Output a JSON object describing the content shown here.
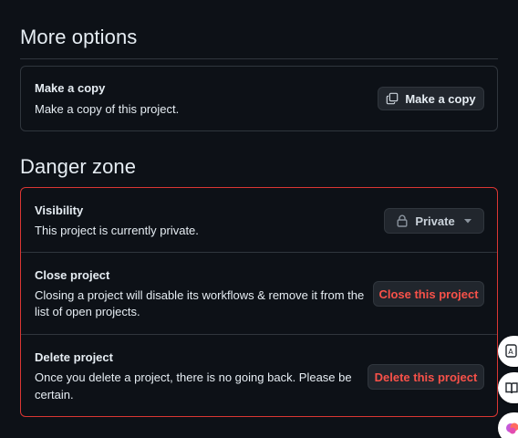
{
  "more_options": {
    "title": "More options",
    "copy": {
      "title": "Make a copy",
      "description": "Make a copy of this project.",
      "button_label": "Make a copy",
      "button_icon": "copy-icon"
    }
  },
  "danger_zone": {
    "title": "Danger zone",
    "visibility": {
      "title": "Visibility",
      "description": "This project is currently private.",
      "button_label": "Private",
      "button_icon": "lock-icon"
    },
    "close": {
      "title": "Close project",
      "description_line1": "Closing a project will disable its workflows & remove it from the",
      "description_line2": "list of open projects.",
      "button_label": "Close this project"
    },
    "delete": {
      "title": "Delete project",
      "description_line1": "Once you delete a project, there is no going back. Please be",
      "description_line2": "certain.",
      "button_label": "Delete this project"
    }
  },
  "floating_tools": [
    "translate-icon",
    "book-icon",
    "brain-icon"
  ],
  "colors": {
    "background": "#0d1117",
    "border": "#30363d",
    "danger_border": "#da3633",
    "danger_text": "#f85149",
    "button_bg": "#21262d"
  }
}
